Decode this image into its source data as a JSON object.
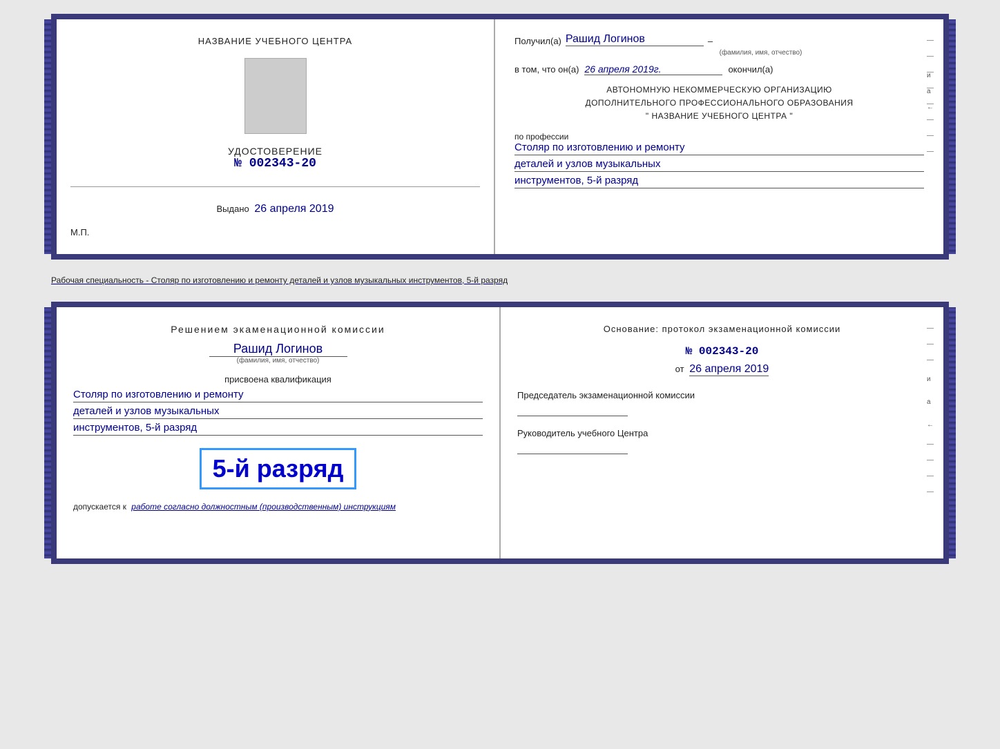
{
  "top_doc": {
    "left": {
      "center_title": "НАЗВАНИЕ УЧЕБНОГО ЦЕНТРА",
      "photo_alt": "фото",
      "cert_label": "УДОСТОВЕРЕНИЕ",
      "cert_number_prefix": "№",
      "cert_number": "002343-20",
      "issued_label": "Выдано",
      "issued_date": "26 апреля 2019",
      "mp_label": "М.П."
    },
    "right": {
      "received_label": "Получил(а)",
      "recipient_name": "Рашид Логинов",
      "name_sub": "(фамилия, имя, отчество)",
      "dash": "–",
      "in_that_label": "в том, что он(а)",
      "completed_date": "26 апреля 2019г.",
      "completed_label": "окончил(а)",
      "org_block_line1": "АВТОНОМНУЮ НЕКОММЕРЧЕСКУЮ ОРГАНИЗАЦИЮ",
      "org_block_line2": "ДОПОЛНИТЕЛЬНОГО ПРОФЕССИОНАЛЬНОГО ОБРАЗОВАНИЯ",
      "org_block_line3": "\"   НАЗВАНИЕ УЧЕБНОГО ЦЕНТРА   \"",
      "profession_label": "по профессии",
      "profession_line1": "Столяр по изготовлению и ремонту",
      "profession_line2": "деталей и узлов музыкальных",
      "profession_line3": "инструментов, 5-й разряд"
    }
  },
  "between_text": "Рабочая специальность - Столяр по изготовлению и ремонту деталей и узлов музыкальных инструментов, 5-й разряд",
  "bottom_doc": {
    "left": {
      "decision_title": "Решением экаменационной комиссии",
      "name": "Рашид Логинов",
      "name_sub": "(фамилия, имя, отчество)",
      "qualification_label": "присвоена квалификация",
      "qual_line1": "Столяр по изготовлению и ремонту",
      "qual_line2": "деталей и узлов музыкальных",
      "qual_line3": "инструментов, 5-й разряд",
      "rank_label": "5-й разряд",
      "allowed_label": "допускается к",
      "allowed_handwritten": "работе согласно должностным (производственным) инструкциям"
    },
    "right": {
      "basis_label": "Основание: протокол экзаменационной комиссии",
      "number_prefix": "№",
      "number": "002343-20",
      "date_prefix": "от",
      "date": "26 апреля 2019",
      "chairman_label": "Председатель экзаменационной комиссии",
      "director_label": "Руководитель учебного Центра"
    }
  }
}
